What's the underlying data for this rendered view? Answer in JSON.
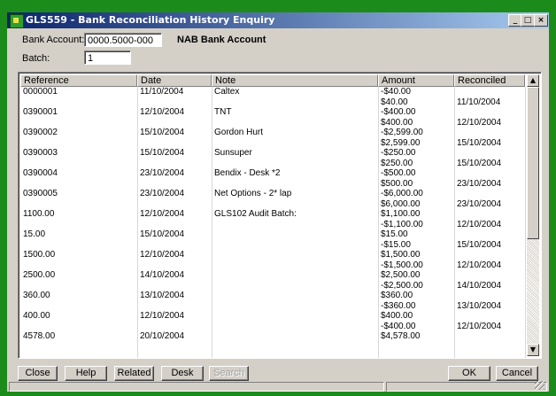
{
  "window": {
    "title": "GLS559 - Bank Reconciliation History Enquiry"
  },
  "form": {
    "bank_account_label": "Bank Account:",
    "bank_account_value": "0000.5000-000",
    "bank_account_name": "NAB Bank Account",
    "batch_label": "Batch:",
    "batch_value": "1"
  },
  "table": {
    "columns": [
      "Reference",
      "Date",
      "Note",
      "Amount",
      "Reconciled"
    ],
    "rows": [
      [
        "0000001",
        "11/10/2004",
        "Caltex",
        "-$40.00",
        ""
      ],
      [
        "",
        "",
        "",
        "$40.00",
        "11/10/2004"
      ],
      [
        "0390001",
        "12/10/2004",
        "TNT",
        "-$400.00",
        ""
      ],
      [
        "",
        "",
        "",
        "$400.00",
        "12/10/2004"
      ],
      [
        "0390002",
        "15/10/2004",
        "Gordon Hurt",
        "-$2,599.00",
        ""
      ],
      [
        "",
        "",
        "",
        "$2,599.00",
        "15/10/2004"
      ],
      [
        "0390003",
        "15/10/2004",
        "Sunsuper",
        "-$250.00",
        ""
      ],
      [
        "",
        "",
        "",
        "$250.00",
        "15/10/2004"
      ],
      [
        "0390004",
        "23/10/2004",
        "Bendix - Desk *2",
        "-$500.00",
        ""
      ],
      [
        "",
        "",
        "",
        "$500.00",
        "23/10/2004"
      ],
      [
        "0390005",
        "23/10/2004",
        "Net Options - 2* lap",
        "-$6,000.00",
        ""
      ],
      [
        "",
        "",
        "",
        "$6,000.00",
        "23/10/2004"
      ],
      [
        "1100.00",
        "12/10/2004",
        "GLS102 Audit Batch:",
        "$1,100.00",
        ""
      ],
      [
        "",
        "",
        "",
        "-$1,100.00",
        "12/10/2004"
      ],
      [
        "15.00",
        "15/10/2004",
        "",
        "$15.00",
        ""
      ],
      [
        "",
        "",
        "",
        "-$15.00",
        "15/10/2004"
      ],
      [
        "1500.00",
        "12/10/2004",
        "",
        "$1,500.00",
        ""
      ],
      [
        "",
        "",
        "",
        "-$1,500.00",
        "12/10/2004"
      ],
      [
        "2500.00",
        "14/10/2004",
        "",
        "$2,500.00",
        ""
      ],
      [
        "",
        "",
        "",
        "-$2,500.00",
        "14/10/2004"
      ],
      [
        "360.00",
        "13/10/2004",
        "",
        "$360.00",
        ""
      ],
      [
        "",
        "",
        "",
        "-$360.00",
        "13/10/2004"
      ],
      [
        "400.00",
        "12/10/2004",
        "",
        "$400.00",
        ""
      ],
      [
        "",
        "",
        "",
        "-$400.00",
        "12/10/2004"
      ],
      [
        "4578.00",
        "20/10/2004",
        "",
        "$4,578.00",
        ""
      ]
    ]
  },
  "buttons": {
    "close": "Close",
    "help": "Help",
    "related": "Related",
    "desk": "Desk",
    "search": "Search",
    "ok": "OK",
    "cancel": "Cancel"
  },
  "titlebar_buttons": {
    "minimize": "_",
    "maximize": "□",
    "close": "×"
  }
}
